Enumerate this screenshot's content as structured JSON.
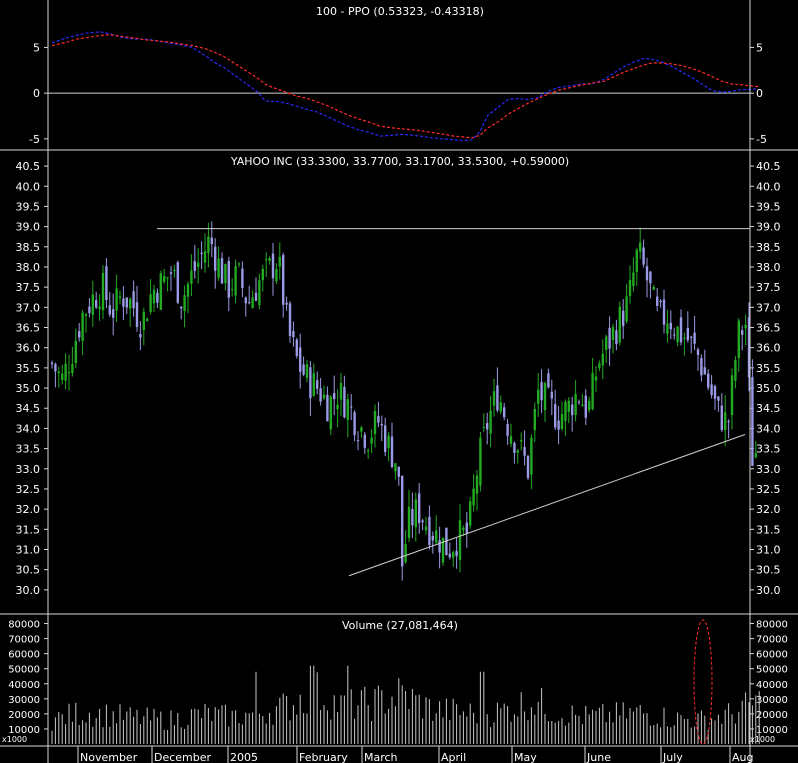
{
  "colors": {
    "background": "#000000",
    "frame": "#d8d8d8",
    "up_candle": "#22aa22",
    "down_candle": "#9a9ae6",
    "ppo_line": "#2a2aff",
    "ppo_signal": "#ff2a2a",
    "volume_bar": "#c8c8c8",
    "trendline": "#d0d0d0",
    "highlight_ellipse": "#ff2a2a",
    "text": "#ffffff"
  },
  "chart_data": [
    {
      "type": "line",
      "title": "100 - PPO (0.53323, -0.43318)",
      "ylim": [
        -6,
        8
      ],
      "yticks": [
        "5",
        "0",
        "-5"
      ],
      "ytick_values": [
        5,
        0,
        -5
      ],
      "x": [
        0,
        8,
        16,
        24,
        36,
        48,
        58,
        70,
        84,
        96,
        106,
        116,
        128,
        140,
        152,
        162,
        172,
        182,
        192,
        206,
        212,
        216,
        224,
        234,
        244,
        256,
        266,
        276,
        286,
        296,
        306,
        318,
        328,
        340,
        350,
        360,
        368,
        380,
        392,
        402,
        412,
        420,
        428,
        436,
        448,
        456,
        466,
        476,
        486,
        496,
        506,
        518,
        530,
        540,
        552,
        562,
        572,
        582,
        592,
        600,
        610,
        620,
        630,
        640,
        650,
        660,
        670,
        680,
        690,
        698,
        706
      ],
      "series": [
        {
          "values": [
            5.5,
            5.8,
            6.1,
            6.3,
            6.6,
            6.7,
            6.5,
            6.1,
            5.9,
            5.9,
            5.7,
            5.5,
            5.3,
            5.0,
            4.2,
            3.4,
            2.8,
            2.0,
            1.2,
            0.1,
            -0.7,
            -0.9,
            -0.9,
            -1.1,
            -1.4,
            -1.8,
            -2.1,
            -2.6,
            -3.1,
            -3.6,
            -4.0,
            -4.3,
            -4.7,
            -4.6,
            -4.5,
            -4.6,
            -4.7,
            -4.9,
            -5.0,
            -5.1,
            -5.2,
            -5.1,
            -4.2,
            -2.4,
            -1.4,
            -0.7,
            -0.6,
            -0.7,
            -0.5,
            0.2,
            0.6,
            0.8,
            1.0,
            1.0,
            1.5,
            2.2,
            2.9,
            3.4,
            3.8,
            3.7,
            3.4,
            2.9,
            2.3,
            1.7,
            1.0,
            0.3,
            0.1,
            0.2,
            0.4,
            0.4,
            0.5
          ]
        },
        {
          "values": [
            5.2,
            5.4,
            5.6,
            5.9,
            6.1,
            6.3,
            6.4,
            6.2,
            6.0,
            5.8,
            5.7,
            5.6,
            5.4,
            5.2,
            4.9,
            4.5,
            4.0,
            3.3,
            2.6,
            1.6,
            1.1,
            0.8,
            0.5,
            0.1,
            -0.3,
            -0.6,
            -1.0,
            -1.4,
            -1.9,
            -2.4,
            -2.8,
            -3.2,
            -3.6,
            -3.8,
            -3.9,
            -4.0,
            -4.1,
            -4.3,
            -4.5,
            -4.7,
            -4.8,
            -4.9,
            -4.6,
            -3.8,
            -3.0,
            -2.3,
            -1.7,
            -1.1,
            -0.6,
            -0.1,
            0.3,
            0.6,
            0.9,
            1.1,
            1.3,
            1.8,
            2.3,
            2.7,
            3.1,
            3.3,
            3.3,
            3.2,
            3.0,
            2.7,
            2.3,
            1.8,
            1.3,
            1.0,
            0.9,
            0.8,
            0.7
          ]
        }
      ]
    },
    {
      "type": "candlestick",
      "title": "YAHOO INC (33.3300, 33.7700, 33.1700, 33.5300, +0.59000)",
      "ylim": [
        29.6,
        40.7
      ],
      "yticks": [
        "40.5",
        "40.0",
        "39.5",
        "39.0",
        "38.5",
        "38.0",
        "37.5",
        "37.0",
        "36.5",
        "36.0",
        "35.5",
        "35.0",
        "34.5",
        "34.0",
        "33.5",
        "33.0",
        "32.5",
        "32.0",
        "31.5",
        "31.0",
        "30.5",
        "30.0"
      ],
      "ytick_values": [
        40.5,
        40.0,
        39.5,
        39.0,
        38.5,
        38.0,
        37.5,
        37.0,
        36.5,
        36.0,
        35.5,
        35.0,
        34.5,
        34.0,
        33.5,
        33.0,
        32.5,
        32.0,
        31.5,
        31.0,
        30.5,
        30.0
      ],
      "resistance_level": 38.95,
      "trendline": {
        "from": {
          "x": 349,
          "y": 30.35
        },
        "to": {
          "x": 745,
          "y": 33.85
        }
      },
      "close_path": {
        "x": [
          0,
          10,
          20,
          30,
          40,
          50,
          60,
          70,
          80,
          90,
          100,
          110,
          120,
          130,
          140,
          150,
          158,
          166,
          176,
          186,
          196,
          206,
          216,
          226,
          236,
          246,
          256,
          266,
          276,
          286,
          296,
          306,
          316,
          326,
          336,
          346,
          350,
          356,
          366,
          376,
          386,
          396,
          406,
          416,
          426,
          436,
          446,
          456,
          466,
          476,
          486,
          496,
          506,
          516,
          526,
          536,
          546,
          556,
          566,
          576,
          586,
          596,
          606,
          616,
          626,
          636,
          646,
          656,
          666,
          676,
          686,
          694,
          700,
          706
        ],
        "values": [
          35.6,
          35.2,
          35.9,
          36.8,
          37.2,
          37.5,
          36.9,
          37.3,
          37.1,
          36.6,
          37.4,
          37.6,
          37.9,
          37.2,
          37.8,
          38.3,
          38.7,
          38.1,
          37.5,
          37.8,
          37.1,
          37.6,
          37.9,
          38.2,
          36.4,
          35.6,
          35.2,
          35.0,
          34.6,
          34.9,
          34.6,
          34.1,
          33.8,
          34.2,
          33.6,
          33.1,
          30.6,
          31.6,
          32.0,
          31.6,
          31.3,
          31.0,
          31.3,
          31.4,
          33.1,
          34.2,
          34.9,
          34.1,
          33.6,
          33.0,
          34.9,
          34.6,
          34.3,
          34.5,
          34.9,
          34.4,
          35.6,
          36.1,
          36.6,
          37.1,
          38.4,
          37.6,
          36.7,
          36.8,
          36.4,
          36.2,
          35.8,
          35.1,
          34.4,
          34.1,
          36.3,
          36.6,
          33.3,
          33.5
        ]
      }
    },
    {
      "type": "bar",
      "title": "Volume (27,081,464)",
      "ylim": [
        0,
        85000
      ],
      "yticks": [
        "80000",
        "70000",
        "60000",
        "50000",
        "40000",
        "30000",
        "20000",
        "10000"
      ],
      "ytick_values": [
        80000,
        70000,
        60000,
        50000,
        40000,
        30000,
        20000,
        10000
      ],
      "unit_label": "x1000",
      "x": [
        0,
        30,
        60,
        90,
        120,
        150,
        180,
        210,
        240,
        260,
        290,
        320,
        349,
        380,
        410,
        440,
        482,
        500,
        530,
        560,
        590,
        620,
        650,
        680,
        700,
        708
      ],
      "values": [
        16000,
        21000,
        19000,
        17000,
        16000,
        20000,
        18000,
        21000,
        26000,
        36000,
        25000,
        27000,
        33000,
        23000,
        21000,
        20000,
        29000,
        22000,
        18000,
        19000,
        21000,
        17000,
        16000,
        20000,
        26000,
        28000
      ]
    },
    {
      "type": "axis",
      "xticks": [
        "November",
        "December",
        "2005",
        "February",
        "March",
        "April",
        "May",
        "June",
        "July",
        "Aug"
      ],
      "xtick_values": [
        78,
        152,
        228,
        297,
        362,
        439,
        512,
        585,
        661,
        730
      ]
    }
  ]
}
